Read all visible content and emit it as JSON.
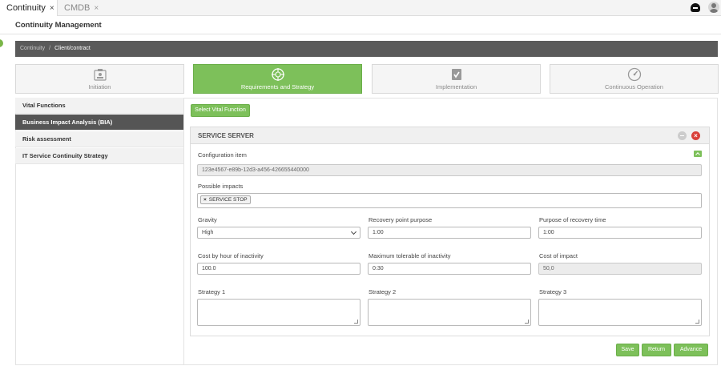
{
  "tabs": [
    {
      "label": "Continuity",
      "close": "×"
    },
    {
      "label": "CMDB",
      "close": "×"
    }
  ],
  "page_title": "Continuity Management",
  "breadcrumb": {
    "root": "Continuity",
    "separator": "/",
    "current": "Client/contract"
  },
  "steps": [
    {
      "label": "Initiation",
      "icon": "clipboard-icon"
    },
    {
      "label": "Requirements and Strategy",
      "icon": "crosshair-icon"
    },
    {
      "label": "Implementation",
      "icon": "checklist-icon"
    },
    {
      "label": "Continuous Operation",
      "icon": "gauge-icon"
    }
  ],
  "nav": [
    {
      "label": "Vital Functions"
    },
    {
      "label": "Business Impact Analysis (BIA)"
    },
    {
      "label": "Risk assessment"
    },
    {
      "label": "IT Service Continuity Strategy"
    }
  ],
  "select_vital_function_label": "Select Vital Function",
  "panel": {
    "title": "SERVICE SERVER",
    "config_item_label": "Configuration item",
    "config_item_value": "123e4567-e89b-12d3-a456-426655440000",
    "impacts_label": "Possible impacts",
    "impact_tag": "SERVICE STOP",
    "impact_tag_remove": "×",
    "gravity_label": "Gravity",
    "gravity_value": "High",
    "rpo_label": "Recovery point purpose",
    "rpo_value": "1:00",
    "rto_label": "Purpose of recovery time",
    "rto_value": "1:00",
    "cost_hour_label": "Cost by hour of inactivity",
    "cost_hour_value": "100.0",
    "mti_label": "Maximum tolerable of inactivity",
    "mti_value": "0:30",
    "cost_impact_label": "Cost of impact",
    "cost_impact_value": "50,0",
    "strategy1_label": "Strategy 1",
    "strategy2_label": "Strategy 2",
    "strategy3_label": "Strategy 3",
    "close_symbol": "×"
  },
  "actions": {
    "save": "Save",
    "return": "Return",
    "advance": "Advance"
  },
  "colors": {
    "accent": "#7dc05a",
    "breadcrumb_bg": "#5a5a5a",
    "close": "#d9413a"
  }
}
